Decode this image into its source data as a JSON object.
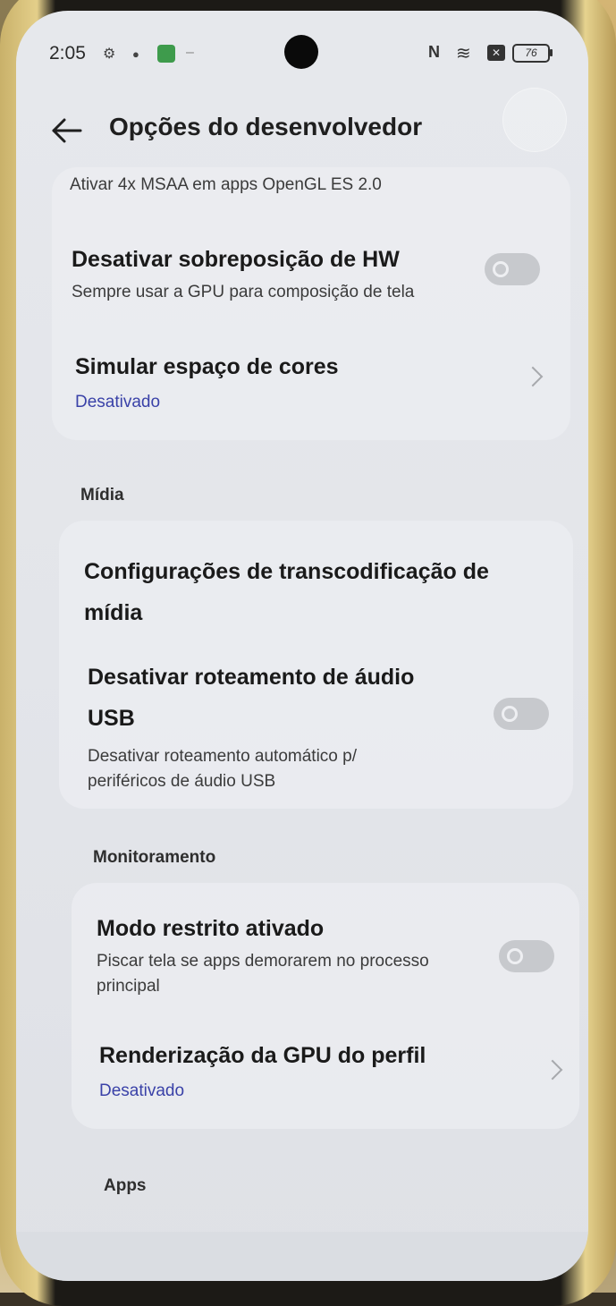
{
  "status_bar": {
    "time": "2:05",
    "battery": "76",
    "icons": [
      "settings-icon",
      "bug-icon",
      "app-notification-icon",
      "nfc-icon",
      "wifi-icon",
      "sim-icon",
      "battery-icon"
    ]
  },
  "header": {
    "title": "Opções do desenvolvedor"
  },
  "top_partial": {
    "subtitle": "Ativar 4x MSAA em apps OpenGL ES 2.0"
  },
  "rows": {
    "hw_overlay": {
      "title": "Desativar sobreposição de HW",
      "subtitle": "Sempre usar a GPU para composição de tela",
      "toggle_on": false
    },
    "color_space": {
      "title": "Simular espaço de cores",
      "value": "Desativado"
    },
    "transcoding": {
      "title_line1": "Configurações de transcodificação de",
      "title_line2": "mídia"
    },
    "usb_audio": {
      "title_line1": "Desativar roteamento de áudio",
      "title_line2": "USB",
      "subtitle_line1": "Desativar roteamento automático p/",
      "subtitle_line2": "periféricos de áudio USB",
      "toggle_on": false
    },
    "strict_mode": {
      "title": "Modo restrito ativado",
      "subtitle_line1": "Piscar tela se apps demorarem no processo",
      "subtitle_line2": "principal",
      "toggle_on": false
    },
    "gpu_render": {
      "title": "Renderização da GPU do perfil",
      "value": "Desativado"
    }
  },
  "sections": {
    "media": "Mídia",
    "monitoring": "Monitoramento",
    "apps": "Apps"
  },
  "colors": {
    "accent_value": "#3a42a8",
    "toggle_off": "#c7c9cd"
  }
}
